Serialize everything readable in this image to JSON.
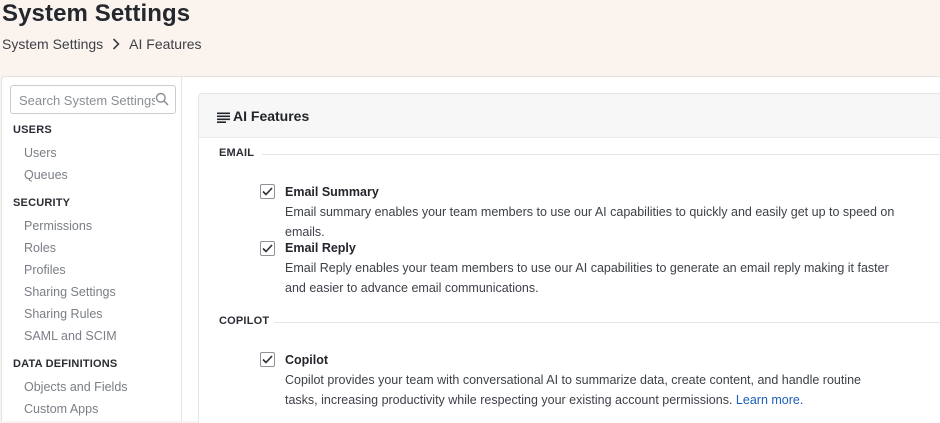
{
  "header": {
    "title": "System Settings",
    "breadcrumb": [
      "System Settings",
      "AI Features"
    ]
  },
  "sidebar": {
    "search_placeholder": "Search System Settings",
    "groups": [
      {
        "title": "USERS",
        "items": [
          "Users",
          "Queues"
        ]
      },
      {
        "title": "SECURITY",
        "items": [
          "Permissions",
          "Roles",
          "Profiles",
          "Sharing Settings",
          "Sharing Rules",
          "SAML and SCIM"
        ]
      },
      {
        "title": "DATA DEFINITIONS",
        "items": [
          "Objects and Fields",
          "Custom Apps"
        ]
      }
    ]
  },
  "panel": {
    "title": "AI Features",
    "sections": [
      {
        "label": "EMAIL",
        "features": [
          {
            "title": "Email Summary",
            "checked": true,
            "desc": "Email summary enables your team members to use our AI capabilities to quickly and easily get up to speed on emails."
          },
          {
            "title": "Email Reply",
            "checked": true,
            "desc": "Email Reply enables your team members to use our AI capabilities to generate an email reply making it faster and easier to advance email communications."
          }
        ]
      },
      {
        "label": "COPILOT",
        "features": [
          {
            "title": "Copilot",
            "checked": true,
            "desc": "Copilot provides your team with conversational AI to summarize data, create content, and handle routine tasks, increasing productivity while respecting your existing account permissions.",
            "link": "Learn more."
          }
        ]
      }
    ]
  },
  "colors": {
    "header_bg": "#fbf3ed",
    "link": "#1b5fb8",
    "muted_nav": "#7a7f86"
  }
}
